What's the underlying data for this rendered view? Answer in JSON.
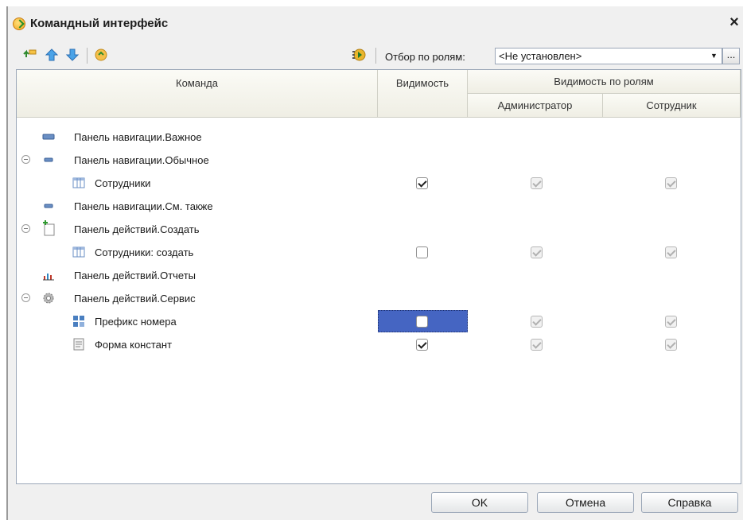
{
  "window": {
    "title": "Командный интерфейс",
    "close_label": "×"
  },
  "toolbar": {
    "filter_label": "Отбор по ролям:",
    "filter_value": "<Не установлен>",
    "dropdown_glyph": "▼",
    "dots_label": "..."
  },
  "columns": {
    "command": "Команда",
    "visibility": "Видимость",
    "roles_group": "Видимость по ролям",
    "role_admin": "Администратор",
    "role_employee": "Сотрудник"
  },
  "rows": [
    {
      "label": "Панель навигации.Важное",
      "icon": "nav-important-icon"
    },
    {
      "label": "Панель навигации.Обычное",
      "icon": "nav-regular-icon",
      "expanded": true
    },
    {
      "label": "Сотрудники",
      "icon": "catalog-icon",
      "visible": true,
      "admin": true,
      "employee": true
    },
    {
      "label": "Панель навигации.См. также",
      "icon": "nav-see-also-icon"
    },
    {
      "label": "Панель действий.Создать",
      "icon": "create-document-icon",
      "expanded": true
    },
    {
      "label": "Сотрудники: создать",
      "icon": "catalog-icon",
      "visible": false,
      "admin": true,
      "employee": true
    },
    {
      "label": "Панель действий.Отчеты",
      "icon": "reports-chart-icon"
    },
    {
      "label": "Панель действий.Сервис",
      "icon": "service-gear-icon",
      "expanded": true
    },
    {
      "label": "Префикс номера",
      "icon": "processing-icon",
      "visible": false,
      "admin": true,
      "employee": true,
      "selected": true
    },
    {
      "label": "Форма констант",
      "icon": "constants-form-icon",
      "visible": true,
      "admin": true,
      "employee": true
    }
  ],
  "buttons": {
    "ok": "OK",
    "cancel": "Отмена",
    "help": "Справка"
  }
}
